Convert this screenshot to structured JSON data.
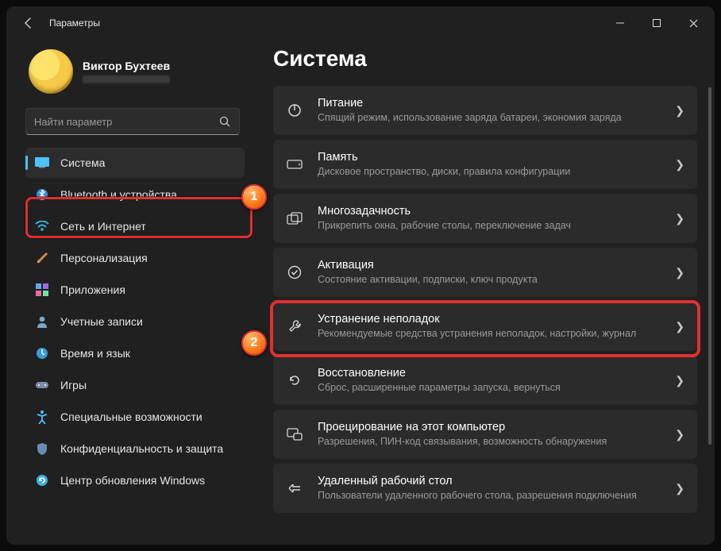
{
  "window": {
    "title": "Параметры"
  },
  "profile": {
    "name": "Виктор Бухтеев"
  },
  "search": {
    "placeholder": "Найти параметр"
  },
  "sidebar": {
    "items": [
      {
        "label": "Система"
      },
      {
        "label": "Bluetooth и устройства"
      },
      {
        "label": "Сеть и Интернет"
      },
      {
        "label": "Персонализация"
      },
      {
        "label": "Приложения"
      },
      {
        "label": "Учетные записи"
      },
      {
        "label": "Время и язык"
      },
      {
        "label": "Игры"
      },
      {
        "label": "Специальные возможности"
      },
      {
        "label": "Конфиденциальность и защита"
      },
      {
        "label": "Центр обновления Windows"
      }
    ]
  },
  "main": {
    "heading": "Система",
    "cards": [
      {
        "title": "Питание",
        "sub": "Спящий режим, использование заряда батареи, экономия заряда"
      },
      {
        "title": "Память",
        "sub": "Дисковое пространство, диски, правила конфигурации"
      },
      {
        "title": "Многозадачность",
        "sub": "Прикрепить окна, рабочие столы, переключение задач"
      },
      {
        "title": "Активация",
        "sub": "Состояние активации, подписки, ключ продукта"
      },
      {
        "title": "Устранение неполадок",
        "sub": "Рекомендуемые средства устранения неполадок, настройки, журнал"
      },
      {
        "title": "Восстановление",
        "sub": "Сброс, расширенные параметры запуска, вернуться"
      },
      {
        "title": "Проецирование на этот компьютер",
        "sub": "Разрешения, ПИН-код связывания, возможность обнаружения"
      },
      {
        "title": "Удаленный рабочий стол",
        "sub": "Пользователи удаленного рабочего стола, разрешения подключения"
      }
    ]
  },
  "markers": {
    "one": "1",
    "two": "2"
  }
}
